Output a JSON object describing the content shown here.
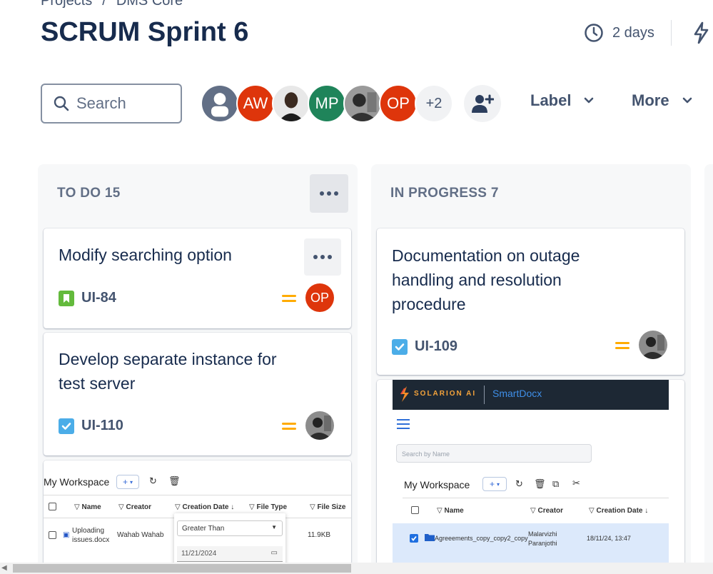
{
  "breadcrumb": {
    "projects": "Projects",
    "separator": "/",
    "project": "DMS Core"
  },
  "sprint": {
    "title": "SCRUM Sprint 6",
    "time_remaining": "2 days"
  },
  "search": {
    "placeholder": "Search"
  },
  "avatars": [
    {
      "initials": "",
      "kind": "default",
      "color": "#626f86"
    },
    {
      "initials": "AW",
      "kind": "initials",
      "color": "#de350b"
    },
    {
      "initials": "",
      "kind": "photo",
      "color": "#2b2b2b"
    },
    {
      "initials": "MP",
      "kind": "initials",
      "color": "#1f845a"
    },
    {
      "initials": "",
      "kind": "photo",
      "color": "#3a3a3a"
    },
    {
      "initials": "OP",
      "kind": "initials",
      "color": "#de350b"
    }
  ],
  "avatar_overflow": "+2",
  "filters": {
    "label": "Label",
    "more": "More"
  },
  "columns": [
    {
      "title": "TO DO 15",
      "cards": [
        {
          "title": "Modify searching option",
          "key": "UI-84",
          "type": "story",
          "assignee": "OP"
        },
        {
          "title_line1": "Develop separate instance for",
          "title_line2": "test server",
          "key": "UI-110",
          "type": "task",
          "assignee": ""
        }
      ],
      "attachment": {
        "workspace_title": "My Workspace",
        "plus": "+",
        "headers": [
          "Name",
          "Creator",
          "Creation Date",
          "File Type",
          "File Size"
        ],
        "row": {
          "name_line1": "Uploading",
          "name_line2": "issues.docx",
          "creator": "Wahab Wahab",
          "size": "11.9KB"
        },
        "filter_select": "Greater Than",
        "filter_date": "11/21/2024"
      }
    },
    {
      "title": "IN PROGRESS 7",
      "cards": [
        {
          "title_line1": "Documentation on outage",
          "title_line2": "handling and resolution",
          "title_line3": "procedure",
          "key": "UI-109",
          "type": "task",
          "assignee": ""
        }
      ],
      "attachment": {
        "brand": "SOLARION AI",
        "product": "SmartDocx",
        "search_placeholder": "Search by Name",
        "workspace_title": "My Workspace",
        "plus": "+",
        "headers": [
          "Name",
          "Creator",
          "Creation Date"
        ],
        "row": {
          "name": "Agreeements_copy_copy2_copy",
          "creator_line1": "Malarvizhi",
          "creator_line2": "Paranjothi",
          "date": "18/11/24, 13:47"
        }
      }
    }
  ],
  "colors": {
    "story": "#63ba3c",
    "task": "#4bade8",
    "priority_medium": "#ffab00",
    "brand_dark": "#1d2834",
    "selected_row": "#dce9fb"
  }
}
